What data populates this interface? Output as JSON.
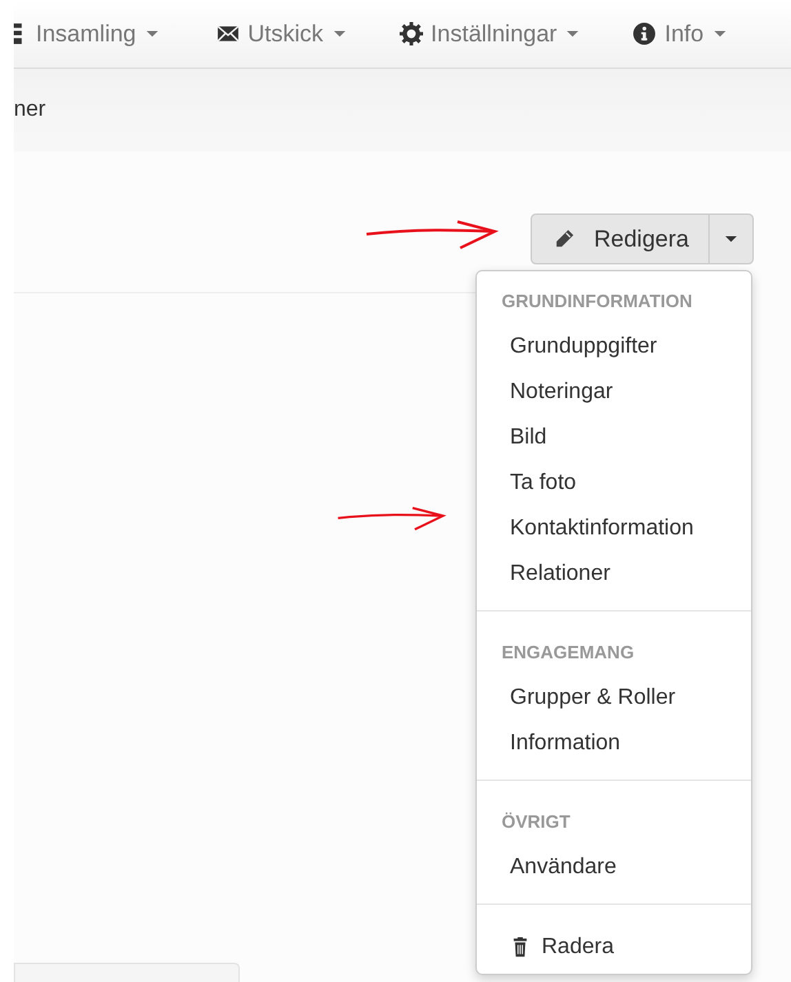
{
  "navbar": {
    "items": [
      {
        "label": "Insamling"
      },
      {
        "label": "Utskick"
      },
      {
        "label": "Inställningar"
      },
      {
        "label": "Info"
      }
    ]
  },
  "subnav": {
    "text": "ner"
  },
  "edit_button": {
    "label": "Redigera"
  },
  "menu": {
    "sections": [
      {
        "header": "GRUNDINFORMATION",
        "items": [
          {
            "label": "Grunduppgifter"
          },
          {
            "label": "Noteringar"
          },
          {
            "label": "Bild"
          },
          {
            "label": "Ta foto"
          },
          {
            "label": "Kontaktinformation"
          },
          {
            "label": "Relationer"
          }
        ]
      },
      {
        "header": "ENGAGEMANG",
        "items": [
          {
            "label": "Grupper & Roller"
          },
          {
            "label": "Information"
          }
        ]
      },
      {
        "header": "ÖVRIGT",
        "items": [
          {
            "label": "Användare"
          }
        ]
      },
      {
        "items": [
          {
            "label": "Radera",
            "kind": "delete"
          }
        ]
      }
    ]
  }
}
